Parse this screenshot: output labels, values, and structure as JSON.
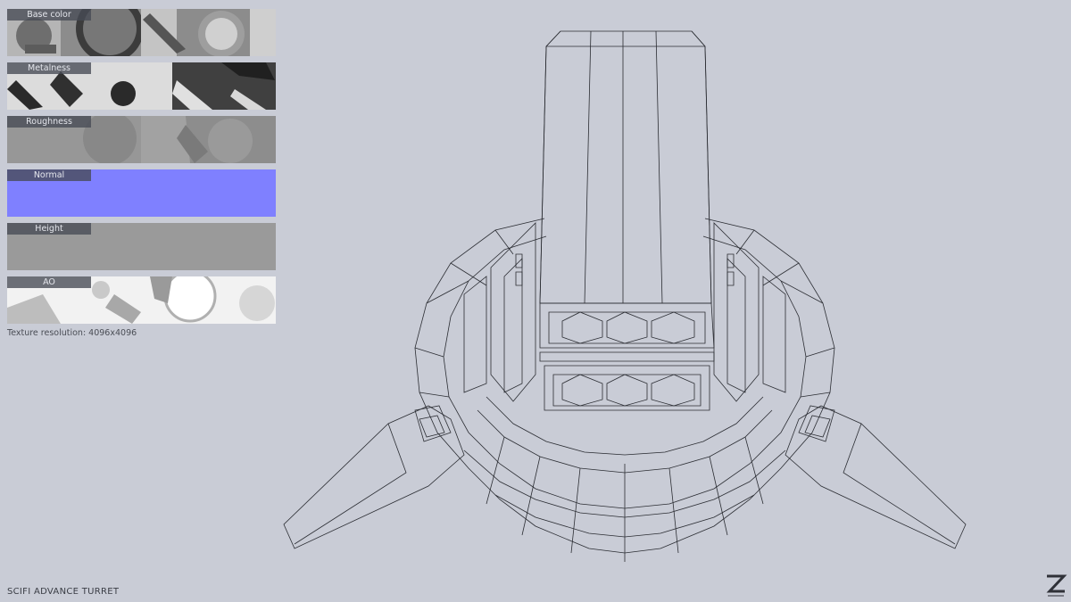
{
  "textures": {
    "base_color": "Base color",
    "metalness": "Metalness",
    "roughness": "Roughness",
    "normal": "Normal",
    "height": "Height",
    "ao": "AO"
  },
  "texture_resolution": "Texture resolution: 4096x4096",
  "model_title": "SCIFI ADVANCE TURRET",
  "colors": {
    "background": "#c9ccd6",
    "normal_map": "#7f80ff",
    "height_map": "#9a9a9a",
    "wire": "#2b2d33"
  },
  "icons": {
    "logo": "z-logo-icon"
  }
}
